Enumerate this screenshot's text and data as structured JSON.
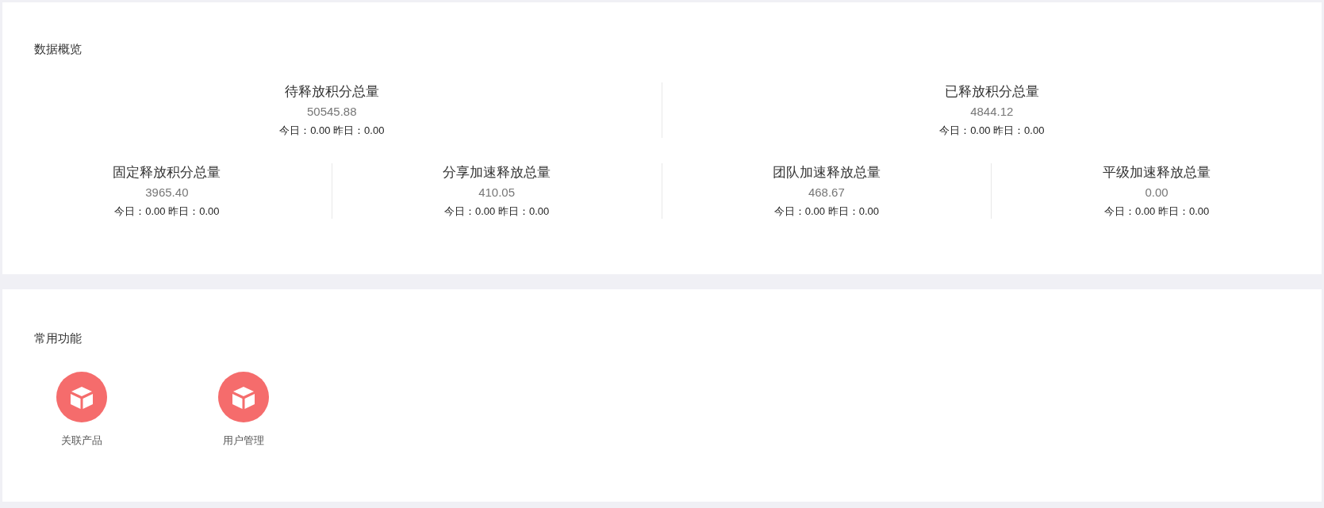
{
  "overview": {
    "title": "数据概览",
    "top_stats": [
      {
        "label": "待释放积分总量",
        "value": "50545.88",
        "detail": "今日：0.00 昨日：0.00"
      },
      {
        "label": "已释放积分总量",
        "value": "4844.12",
        "detail": "今日：0.00 昨日：0.00"
      }
    ],
    "bottom_stats": [
      {
        "label": "固定释放积分总量",
        "value": "3965.40",
        "detail": "今日：0.00 昨日：0.00"
      },
      {
        "label": "分享加速释放总量",
        "value": "410.05",
        "detail": "今日：0.00 昨日：0.00"
      },
      {
        "label": "团队加速释放总量",
        "value": "468.67",
        "detail": "今日：0.00 昨日：0.00"
      },
      {
        "label": "平级加速释放总量",
        "value": "0.00",
        "detail": "今日：0.00 昨日：0.00"
      }
    ]
  },
  "shortcuts": {
    "title": "常用功能",
    "items": [
      {
        "label": "关联产品"
      },
      {
        "label": "用户管理"
      }
    ]
  }
}
